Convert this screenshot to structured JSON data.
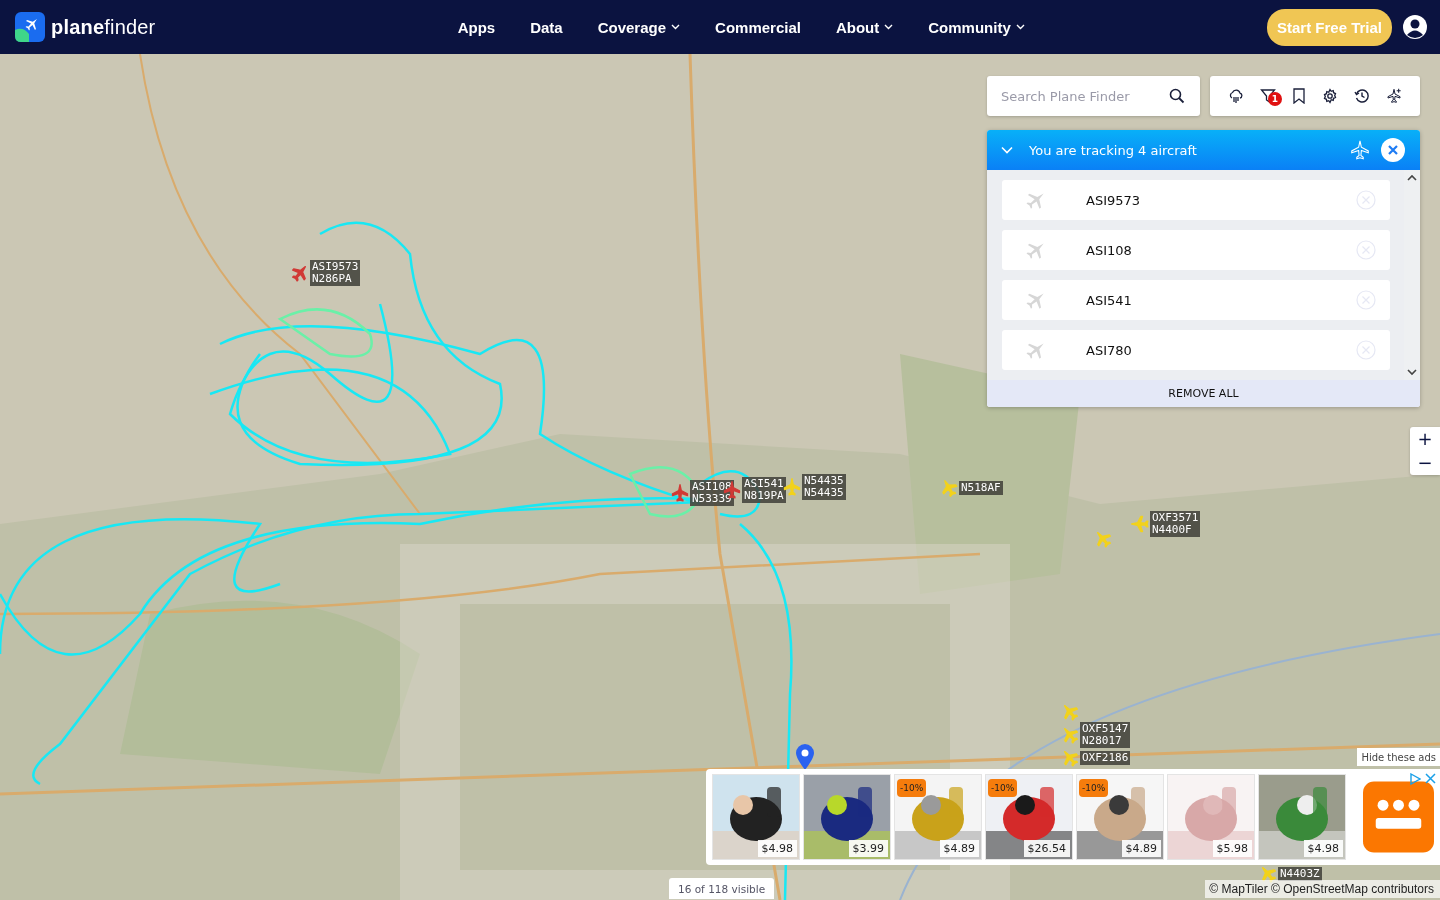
{
  "header": {
    "logo": "**plane**finder",
    "nav": [
      {
        "label": "Apps",
        "dropdown": false
      },
      {
        "label": "Data",
        "dropdown": false
      },
      {
        "label": "Coverage",
        "dropdown": true
      },
      {
        "label": "Commercial",
        "dropdown": false
      },
      {
        "label": "About",
        "dropdown": true
      },
      {
        "label": "Community",
        "dropdown": true
      }
    ],
    "cta": "Start Free Trial"
  },
  "search": {
    "placeholder": "Search Plane Finder"
  },
  "toolbar": {
    "filter_badge": "1"
  },
  "tracking": {
    "title": "You are tracking 4 aircraft",
    "expanded": true,
    "items": [
      {
        "callsign": "ASI9573"
      },
      {
        "callsign": "ASI108"
      },
      {
        "callsign": "ASI541"
      },
      {
        "callsign": "ASI780"
      }
    ],
    "remove_all": "REMOVE ALL"
  },
  "aircraft": [
    {
      "lines": [
        "ASI9573",
        "N286PA"
      ],
      "color": "#d13a36"
    },
    {
      "lines": [
        "ASI108",
        "N53339"
      ],
      "color": "#d13a36"
    },
    {
      "lines": [
        "ASI541",
        "N819PA"
      ],
      "color": "#d13a36"
    },
    {
      "lines": [
        "N54435",
        "N54435"
      ],
      "color": "#f2d21b"
    },
    {
      "lines": [
        "N518AF"
      ],
      "color": "#f2d21b"
    },
    {
      "color": "#f2d21b"
    },
    {
      "lines": [
        "OXF3571",
        "N4400F"
      ],
      "color": "#f2d21b"
    },
    {
      "color": "#f2d21b"
    },
    {
      "lines": [
        "OXF5147",
        "N28017"
      ],
      "color": "#f2d21b"
    },
    {
      "lines": [
        "OXF2186"
      ],
      "color": "#f2d21b"
    },
    {
      "lines": [
        "N4403Z"
      ],
      "color": "#f2d21b"
    }
  ],
  "zoom": {
    "in": "+",
    "out": "−"
  },
  "visible_count": "16 of 118 visible",
  "attribution": "© MapTiler © OpenStreetMap contributors",
  "ads": {
    "hide": "Hide these ads",
    "products": [
      {
        "price": "$4.98"
      },
      {
        "price": "$3.99"
      },
      {
        "price": "$4.89",
        "discount": "-10%"
      },
      {
        "price": "$26.54",
        "discount": "-10%"
      },
      {
        "price": "$4.89",
        "discount": "-10%"
      },
      {
        "price": "$5.98"
      },
      {
        "price": "$4.98"
      }
    ]
  }
}
